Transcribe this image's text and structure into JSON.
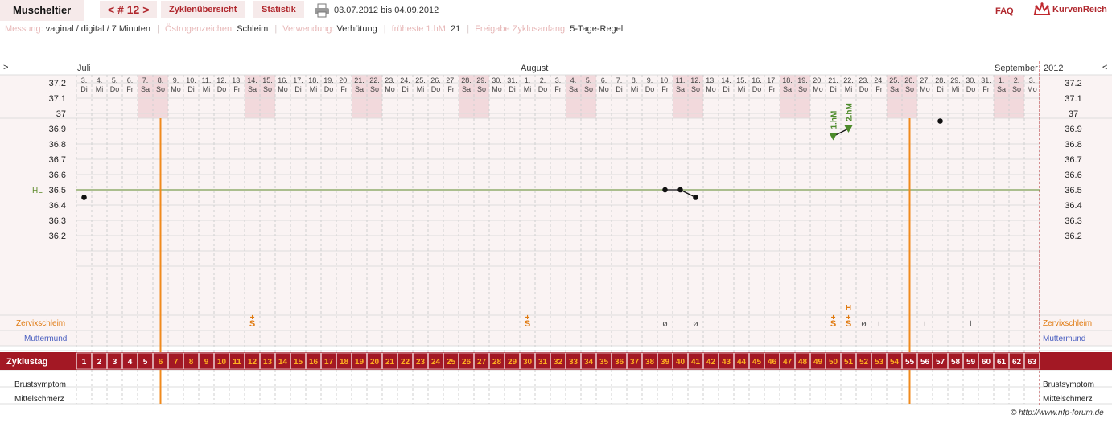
{
  "app": {
    "title": "Muscheltier",
    "nav": "< # 12 >",
    "tab_overview": "Zyklenübersicht",
    "tab_stats": "Statistik",
    "date_range": "03.07.2012 bis 04.09.2012",
    "faq": "FAQ",
    "brand": "KurvenReich"
  },
  "info": {
    "measure_label": "Messung:",
    "measure_value": "vaginal / digital / 7 Minuten",
    "estrogen_label": "Östrogenzeichen:",
    "estrogen_value": "Schleim",
    "usage_label": "Verwendung:",
    "usage_value": "Verhütung",
    "earliest_label": "früheste 1.hM:",
    "earliest_value": "21",
    "release_label": "Freigabe Zyklusanfang:",
    "release_value": "5-Tage-Regel"
  },
  "credit": "© http://www.nfp-forum.de",
  "chart_data": {
    "type": "line",
    "year": "2012",
    "month_labels": [
      {
        "label": "Juli",
        "day_index": 0
      },
      {
        "label": "August",
        "day_index": 29
      },
      {
        "label": "September",
        "day_index": 60
      }
    ],
    "dates": [
      "3.",
      "4.",
      "5.",
      "6.",
      "7.",
      "8.",
      "9.",
      "10.",
      "11.",
      "12.",
      "13.",
      "14.",
      "15.",
      "16.",
      "17.",
      "18.",
      "19.",
      "20.",
      "21.",
      "22.",
      "23.",
      "24.",
      "25.",
      "26.",
      "27.",
      "28.",
      "29.",
      "30.",
      "31.",
      "1.",
      "2.",
      "3.",
      "4.",
      "5.",
      "6.",
      "7.",
      "8.",
      "9.",
      "10.",
      "11.",
      "12.",
      "13.",
      "14.",
      "15.",
      "16.",
      "17.",
      "18.",
      "19.",
      "20.",
      "21.",
      "22.",
      "23.",
      "24.",
      "25.",
      "26.",
      "27.",
      "28.",
      "29.",
      "30.",
      "31.",
      "1.",
      "2.",
      "3."
    ],
    "weekdays": [
      "Di",
      "Mi",
      "Do",
      "Fr",
      "Sa",
      "So",
      "Mo",
      "Di",
      "Mi",
      "Do",
      "Fr",
      "Sa",
      "So",
      "Mo",
      "Di",
      "Mi",
      "Do",
      "Fr",
      "Sa",
      "So",
      "Mo",
      "Di",
      "Mi",
      "Do",
      "Fr",
      "Sa",
      "So",
      "Mo",
      "Di",
      "Mi",
      "Do",
      "Fr",
      "Sa",
      "So",
      "Mo",
      "Di",
      "Mi",
      "Do",
      "Fr",
      "Sa",
      "So",
      "Mo",
      "Di",
      "Mi",
      "Do",
      "Fr",
      "Sa",
      "So",
      "Mo",
      "Di",
      "Mi",
      "Do",
      "Fr",
      "Sa",
      "So",
      "Mo",
      "Di",
      "Mi",
      "Do",
      "Fr",
      "Sa",
      "So",
      "Mo"
    ],
    "cycle_days": [
      1,
      2,
      3,
      4,
      5,
      6,
      7,
      8,
      9,
      10,
      11,
      12,
      13,
      14,
      15,
      16,
      17,
      18,
      19,
      20,
      21,
      22,
      23,
      24,
      25,
      26,
      27,
      28,
      29,
      30,
      31,
      32,
      33,
      34,
      35,
      36,
      37,
      38,
      39,
      40,
      41,
      42,
      43,
      44,
      45,
      46,
      47,
      48,
      49,
      50,
      51,
      52,
      53,
      54,
      55,
      56,
      57,
      58,
      59,
      60,
      61,
      62,
      63
    ],
    "red_cycle_days": [
      6,
      7,
      8,
      9,
      10,
      11,
      12,
      13,
      14,
      15,
      16,
      17,
      18,
      19,
      20,
      21,
      22,
      23,
      24,
      25,
      26,
      27,
      28,
      29,
      30,
      31,
      32,
      33,
      34,
      35,
      36,
      37,
      38,
      39,
      40,
      41,
      42,
      43,
      44,
      45,
      46,
      47,
      48,
      49,
      50,
      51,
      52,
      53,
      54
    ],
    "y_ticks": [
      37.2,
      37.1,
      37,
      36.9,
      36.8,
      36.7,
      36.6,
      36.5,
      36.4,
      36.3,
      36.2
    ],
    "ylim": [
      36.1,
      37.3
    ],
    "coverline": {
      "label": "HL",
      "value": 36.5
    },
    "temperatures": [
      {
        "day": 1,
        "value": 36.45
      },
      {
        "day": 39,
        "value": 36.5
      },
      {
        "day": 40,
        "value": 36.5
      },
      {
        "day": 41,
        "value": 36.45
      },
      {
        "day": 50,
        "value": 36.85
      },
      {
        "day": 51,
        "value": 36.9
      },
      {
        "day": 57,
        "value": 36.95
      }
    ],
    "connected_segments": [
      [
        39,
        41
      ],
      [
        50,
        51
      ]
    ],
    "hm_markers": [
      {
        "day": 50,
        "label": "1.hM"
      },
      {
        "day": 51,
        "label": "2.hM"
      }
    ],
    "cycle_start_markers": [
      5.5,
      54.5
    ],
    "row_labels": {
      "mucus": "Zervixschleim",
      "cervix": "Muttermund",
      "cycle_day": "Zyklustag",
      "breast": "Brustsymptom",
      "midpain": "Mittelschmerz"
    },
    "mucus": [
      {
        "day": 12,
        "symbol": "S",
        "plus": true
      },
      {
        "day": 30,
        "symbol": "S",
        "plus": true
      },
      {
        "day": 39,
        "symbol": "ø"
      },
      {
        "day": 41,
        "symbol": "ø"
      },
      {
        "day": 50,
        "symbol": "S",
        "plus": true
      },
      {
        "day": 51,
        "symbol": "S",
        "plus": true,
        "top": "H"
      },
      {
        "day": 52,
        "symbol": "ø"
      },
      {
        "day": 53,
        "symbol": "t"
      },
      {
        "day": 56,
        "symbol": "t"
      },
      {
        "day": 59,
        "symbol": "t"
      }
    ],
    "nav_left": ">",
    "nav_right": "<"
  }
}
